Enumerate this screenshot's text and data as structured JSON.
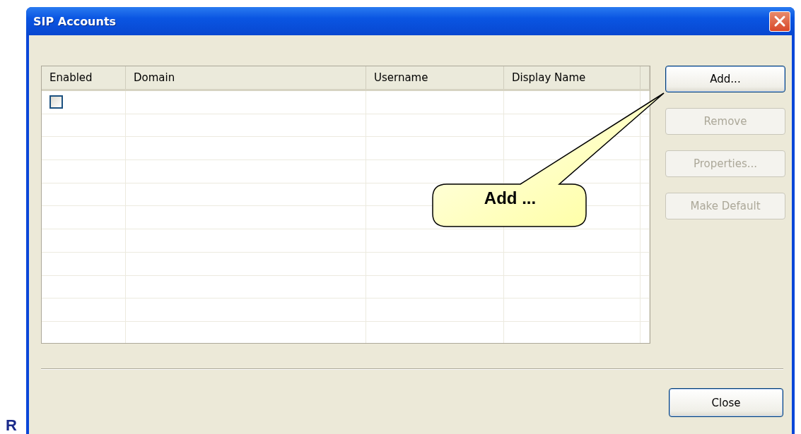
{
  "window": {
    "title": "SIP Accounts"
  },
  "table": {
    "columns": [
      "Enabled",
      "Domain",
      "Username",
      "Display Name"
    ],
    "rows": [
      {
        "enabled": false
      }
    ]
  },
  "buttons": [
    {
      "label": "Add...",
      "disabled": false,
      "focused": true
    },
    {
      "label": "Remove",
      "disabled": true,
      "focused": false
    },
    {
      "label": "Properties...",
      "disabled": true,
      "focused": false
    },
    {
      "label": "Make Default",
      "disabled": true,
      "focused": false
    }
  ],
  "close_button": "Close",
  "callout": {
    "text": "Add ..."
  },
  "stray_text": "R"
}
